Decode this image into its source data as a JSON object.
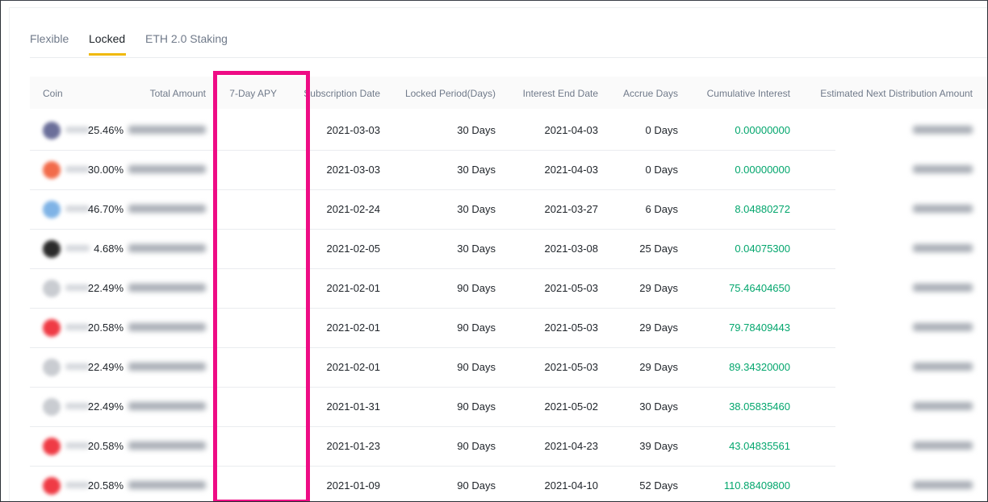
{
  "tabs": [
    {
      "label": "Flexible",
      "active": false
    },
    {
      "label": "Locked",
      "active": true
    },
    {
      "label": "ETH 2.0 Staking",
      "active": false
    }
  ],
  "columns": {
    "coin": "Coin",
    "total_amount": "Total Amount",
    "apy": "7-Day APY",
    "subscription_date": "Subscription Date",
    "locked_period": "Locked Period(Days)",
    "interest_end_date": "Interest End Date",
    "accrue_days": "Accrue Days",
    "cumulative_interest": "Cumulative Interest",
    "next_distribution": "Estimated Next Distribution Amount"
  },
  "rows": [
    {
      "apy": "25.46%",
      "subscription_date": "2021-03-03",
      "locked_period": "30 Days",
      "interest_end_date": "2021-04-03",
      "accrue_days": "0 Days",
      "cumulative_interest": "0.00000000",
      "coin_color": "#6b6f9a"
    },
    {
      "apy": "30.00%",
      "subscription_date": "2021-03-03",
      "locked_period": "30 Days",
      "interest_end_date": "2021-04-03",
      "accrue_days": "0 Days",
      "cumulative_interest": "0.00000000",
      "coin_color": "#f26b4a"
    },
    {
      "apy": "46.70%",
      "subscription_date": "2021-02-24",
      "locked_period": "30 Days",
      "interest_end_date": "2021-03-27",
      "accrue_days": "6 Days",
      "cumulative_interest": "8.04880272",
      "coin_color": "#7fb3e6"
    },
    {
      "apy": "4.68%",
      "subscription_date": "2021-02-05",
      "locked_period": "30 Days",
      "interest_end_date": "2021-03-08",
      "accrue_days": "25 Days",
      "cumulative_interest": "0.04075300",
      "coin_color": "#2b2b2b"
    },
    {
      "apy": "22.49%",
      "subscription_date": "2021-02-01",
      "locked_period": "90 Days",
      "interest_end_date": "2021-05-03",
      "accrue_days": "29 Days",
      "cumulative_interest": "75.46404650",
      "coin_color": "#c9ccd1"
    },
    {
      "apy": "20.58%",
      "subscription_date": "2021-02-01",
      "locked_period": "90 Days",
      "interest_end_date": "2021-05-03",
      "accrue_days": "29 Days",
      "cumulative_interest": "79.78409443",
      "coin_color": "#ef3b45"
    },
    {
      "apy": "22.49%",
      "subscription_date": "2021-02-01",
      "locked_period": "90 Days",
      "interest_end_date": "2021-05-03",
      "accrue_days": "29 Days",
      "cumulative_interest": "89.34320000",
      "coin_color": "#c9ccd1"
    },
    {
      "apy": "22.49%",
      "subscription_date": "2021-01-31",
      "locked_period": "90 Days",
      "interest_end_date": "2021-05-02",
      "accrue_days": "30 Days",
      "cumulative_interest": "38.05835460",
      "coin_color": "#c9ccd1"
    },
    {
      "apy": "20.58%",
      "subscription_date": "2021-01-23",
      "locked_period": "90 Days",
      "interest_end_date": "2021-04-23",
      "accrue_days": "39 Days",
      "cumulative_interest": "43.04835561",
      "coin_color": "#ef3b45"
    },
    {
      "apy": "20.58%",
      "subscription_date": "2021-01-09",
      "locked_period": "90 Days",
      "interest_end_date": "2021-04-10",
      "accrue_days": "52 Days",
      "cumulative_interest": "110.88409800",
      "coin_color": "#ef3b45"
    }
  ],
  "colors": {
    "accent": "#f0b90b",
    "positive": "#03a66d",
    "highlight": "#ee0c85"
  }
}
